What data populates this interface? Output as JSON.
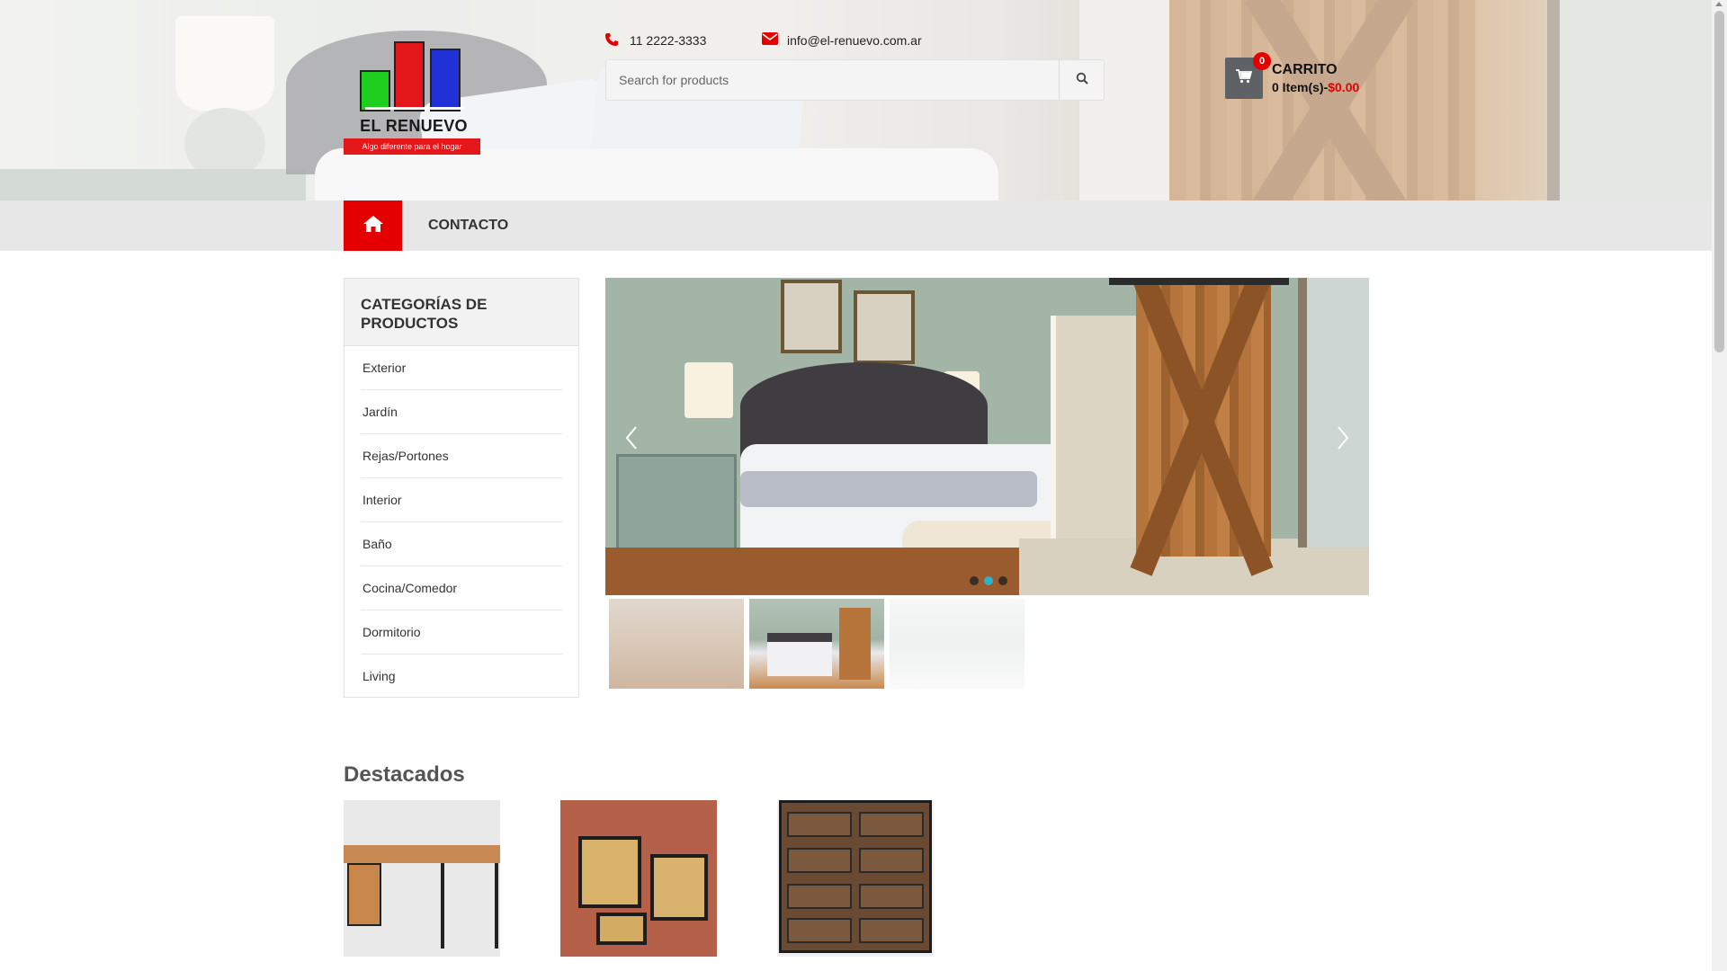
{
  "header": {
    "logo": {
      "brand": "EL RENUEVO",
      "tagline": "Algo diferente para el hogar"
    },
    "phone": "11 2222-3333",
    "email": "info@el-renuevo.com.ar",
    "search": {
      "placeholder": "Search for products"
    },
    "cart": {
      "title": "CARRITO",
      "count": "0",
      "items_label": "0 Item(s)-",
      "total": "$0.00"
    }
  },
  "nav": {
    "home_icon": "home-icon",
    "links": [
      "CONTACTO"
    ]
  },
  "sidebar": {
    "title": "CATEGORÍAS DE PRODUCTOS",
    "items": [
      "Exterior",
      "Jardín",
      "Rejas/Portones",
      "Interior",
      "Baño",
      "Cocina/Comedor",
      "Dormitorio",
      "Living"
    ]
  },
  "slider": {
    "slides": 3,
    "active_slide": 2
  },
  "featured": {
    "title": "Destacados"
  },
  "colors": {
    "accent": "#e50000",
    "nav_bg": "#e7e7e7",
    "cart_box": "#5e6166"
  }
}
